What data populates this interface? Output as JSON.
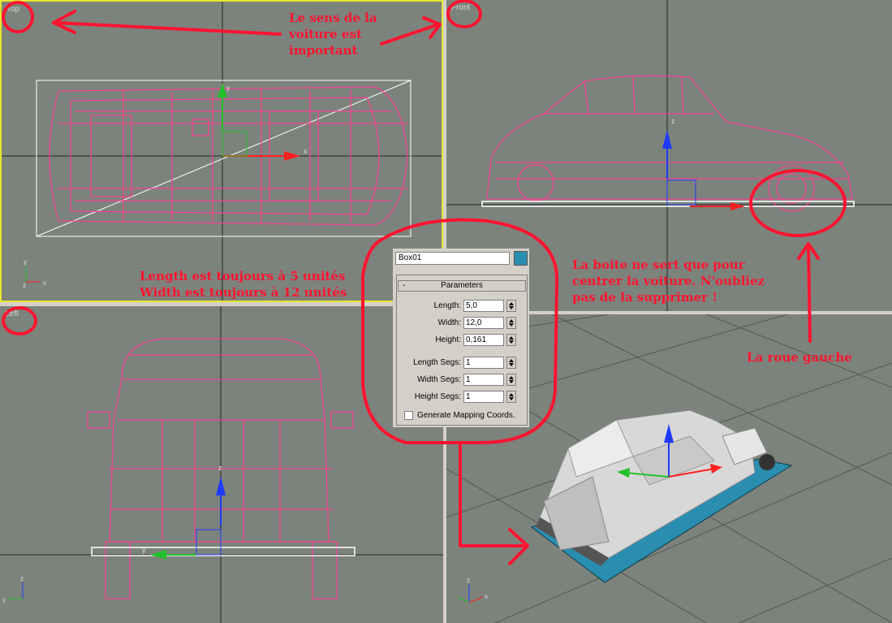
{
  "viewports": {
    "top": "Top",
    "front": "Front",
    "left": "Left"
  },
  "axes": {
    "x": "x",
    "y": "y",
    "z": "z"
  },
  "annotations": {
    "car_direction": "Le sens de la\nvoiture est\nimportant",
    "dimensions": "Length est toujours à 5 unités\nWidth est toujours à 12 unités",
    "box_note": "La boite ne sert que pour\ncentrer la voiture. N'oubliez\npas de la supprimer !",
    "left_wheel": "La roue gauche"
  },
  "panel": {
    "object_name": "Box01",
    "object_color": "#2a8eb0",
    "rollout_title": "Parameters",
    "rollout_toggle": "-",
    "length_label": "Length:",
    "length_value": "5,0",
    "width_label": "Width:",
    "width_value": "12,0",
    "height_label": "Height:",
    "height_value": "0,161",
    "length_segs_label": "Length Segs:",
    "length_segs_value": "1",
    "width_segs_label": "Width Segs:",
    "width_segs_value": "1",
    "height_segs_label": "Height Segs:",
    "height_segs_value": "1",
    "mapping_label": "Generate Mapping Coords."
  },
  "colors": {
    "viewport_bg": "#7c837c",
    "wireframe": "#ff3c96",
    "annotation": "#ff1430",
    "active_border": "#e6e632"
  }
}
